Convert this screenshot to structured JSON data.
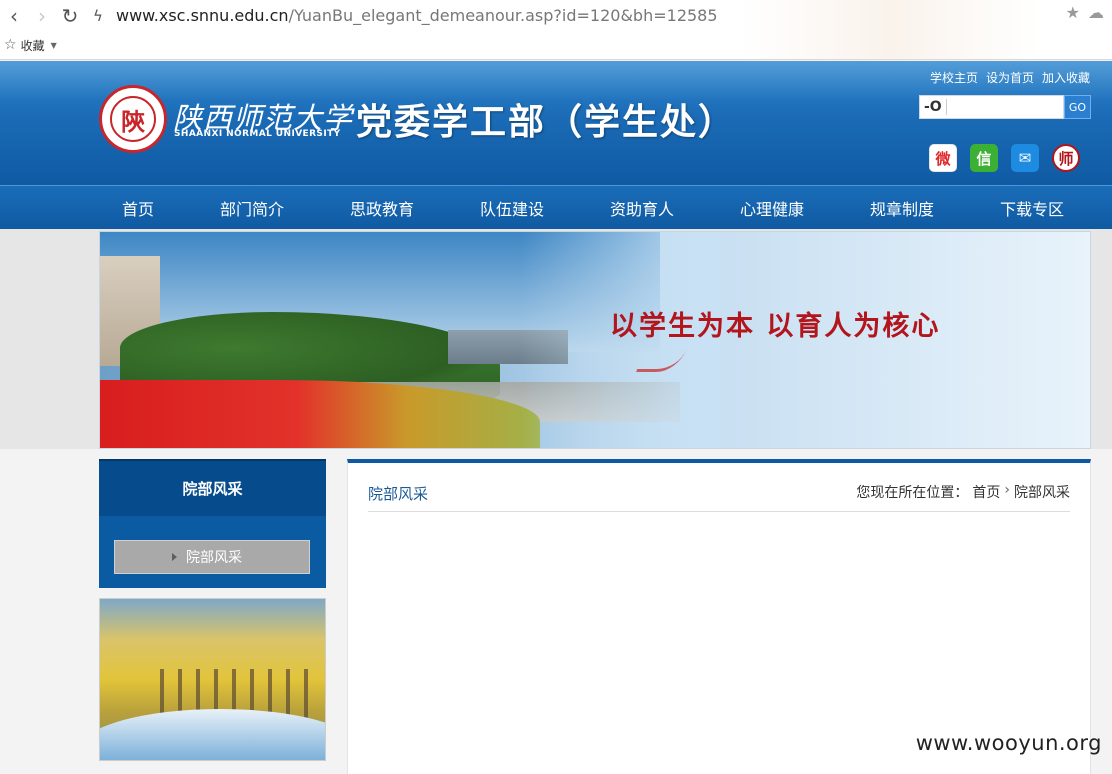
{
  "browser": {
    "url_host": "www.xsc.snnu.edu.cn",
    "url_path": "/YuanBu_elegant_demeanour.asp?id=120&bh=12585",
    "bookmarks_label": "收藏"
  },
  "header": {
    "seal_char": "陝",
    "university_cn": "陕西师范大学",
    "university_en": "SHAANXI NORMAL UNIVERSITY",
    "department": "党委学工部（学生处）",
    "top_links": [
      "学校主页",
      "设为首页",
      "加入收藏"
    ],
    "search": {
      "icon_text": "-O",
      "placeholder": "",
      "button_label": "GO"
    },
    "social": [
      {
        "name": "weibo",
        "glyph": "微"
      },
      {
        "name": "wechat",
        "glyph": "信"
      },
      {
        "name": "mail",
        "glyph": "✉"
      },
      {
        "name": "emblem",
        "glyph": "师"
      }
    ]
  },
  "nav": [
    "首页",
    "部门简介",
    "思政教育",
    "队伍建设",
    "资助育人",
    "心理健康",
    "规章制度",
    "下载专区"
  ],
  "banner": {
    "slogan": "以学生为本  以育人为核心"
  },
  "sidebar": {
    "title": "院部风采",
    "items": [
      {
        "label": "院部风采"
      }
    ]
  },
  "main": {
    "title": "院部风采",
    "breadcrumb_prefix": "您现在所在位置：",
    "breadcrumb": [
      "首页",
      "院部风采"
    ]
  },
  "watermark": "www.wooyun.org",
  "colors": {
    "header_blue": "#1b6bb6",
    "nav_blue": "#0f5aa2",
    "sidebar_dark": "#064b8c",
    "slogan_red": "#b3151d"
  }
}
